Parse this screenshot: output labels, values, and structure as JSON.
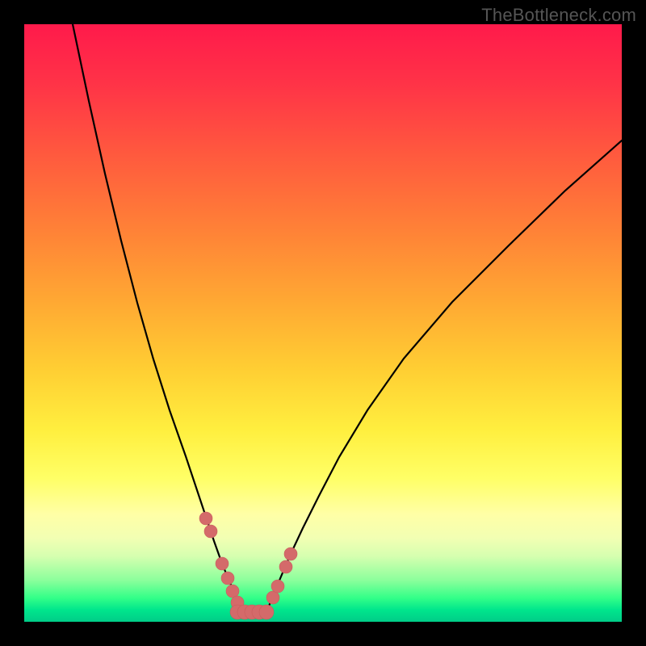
{
  "watermark": "TheBottleneck.com",
  "colors": {
    "page_bg": "#000000",
    "curve": "#000000",
    "bead": "#d46a6a",
    "gradient_top": "#ff1a4b",
    "gradient_bottom": "#00cc88"
  },
  "chart_data": {
    "type": "line",
    "title": "",
    "xlabel": "",
    "ylabel": "",
    "xlim": [
      0,
      740
    ],
    "ylim_note": "y in pixel coords, 0=top, 740=bottom; lower y means worse (red), higher y means better (green)",
    "series": [
      {
        "name": "left-curve",
        "x": [
          60,
          80,
          100,
          120,
          140,
          160,
          180,
          200,
          215,
          225,
          235,
          245,
          255,
          263,
          271
        ],
        "y": [
          0,
          95,
          185,
          268,
          345,
          415,
          478,
          535,
          580,
          610,
          640,
          668,
          692,
          710,
          728
        ]
      },
      {
        "name": "right-curve",
        "x": [
          300,
          308,
          318,
          330,
          345,
          365,
          390,
          425,
          470,
          530,
          600,
          670,
          740
        ],
        "y": [
          728,
          708,
          684,
          656,
          624,
          584,
          536,
          478,
          414,
          344,
          274,
          206,
          144
        ]
      }
    ],
    "beads": {
      "name": "data-beads-near-minimum",
      "left_cluster": [
        {
          "x": 225,
          "y": 612
        },
        {
          "x": 231,
          "y": 628
        },
        {
          "x": 245,
          "y": 668
        },
        {
          "x": 252,
          "y": 686
        },
        {
          "x": 258,
          "y": 702
        },
        {
          "x": 264,
          "y": 716
        }
      ],
      "right_cluster": [
        {
          "x": 308,
          "y": 710
        },
        {
          "x": 314,
          "y": 696
        },
        {
          "x": 324,
          "y": 672
        },
        {
          "x": 330,
          "y": 656
        }
      ],
      "bottom_bar": {
        "x0": 264,
        "x1": 306,
        "y": 728
      }
    }
  }
}
